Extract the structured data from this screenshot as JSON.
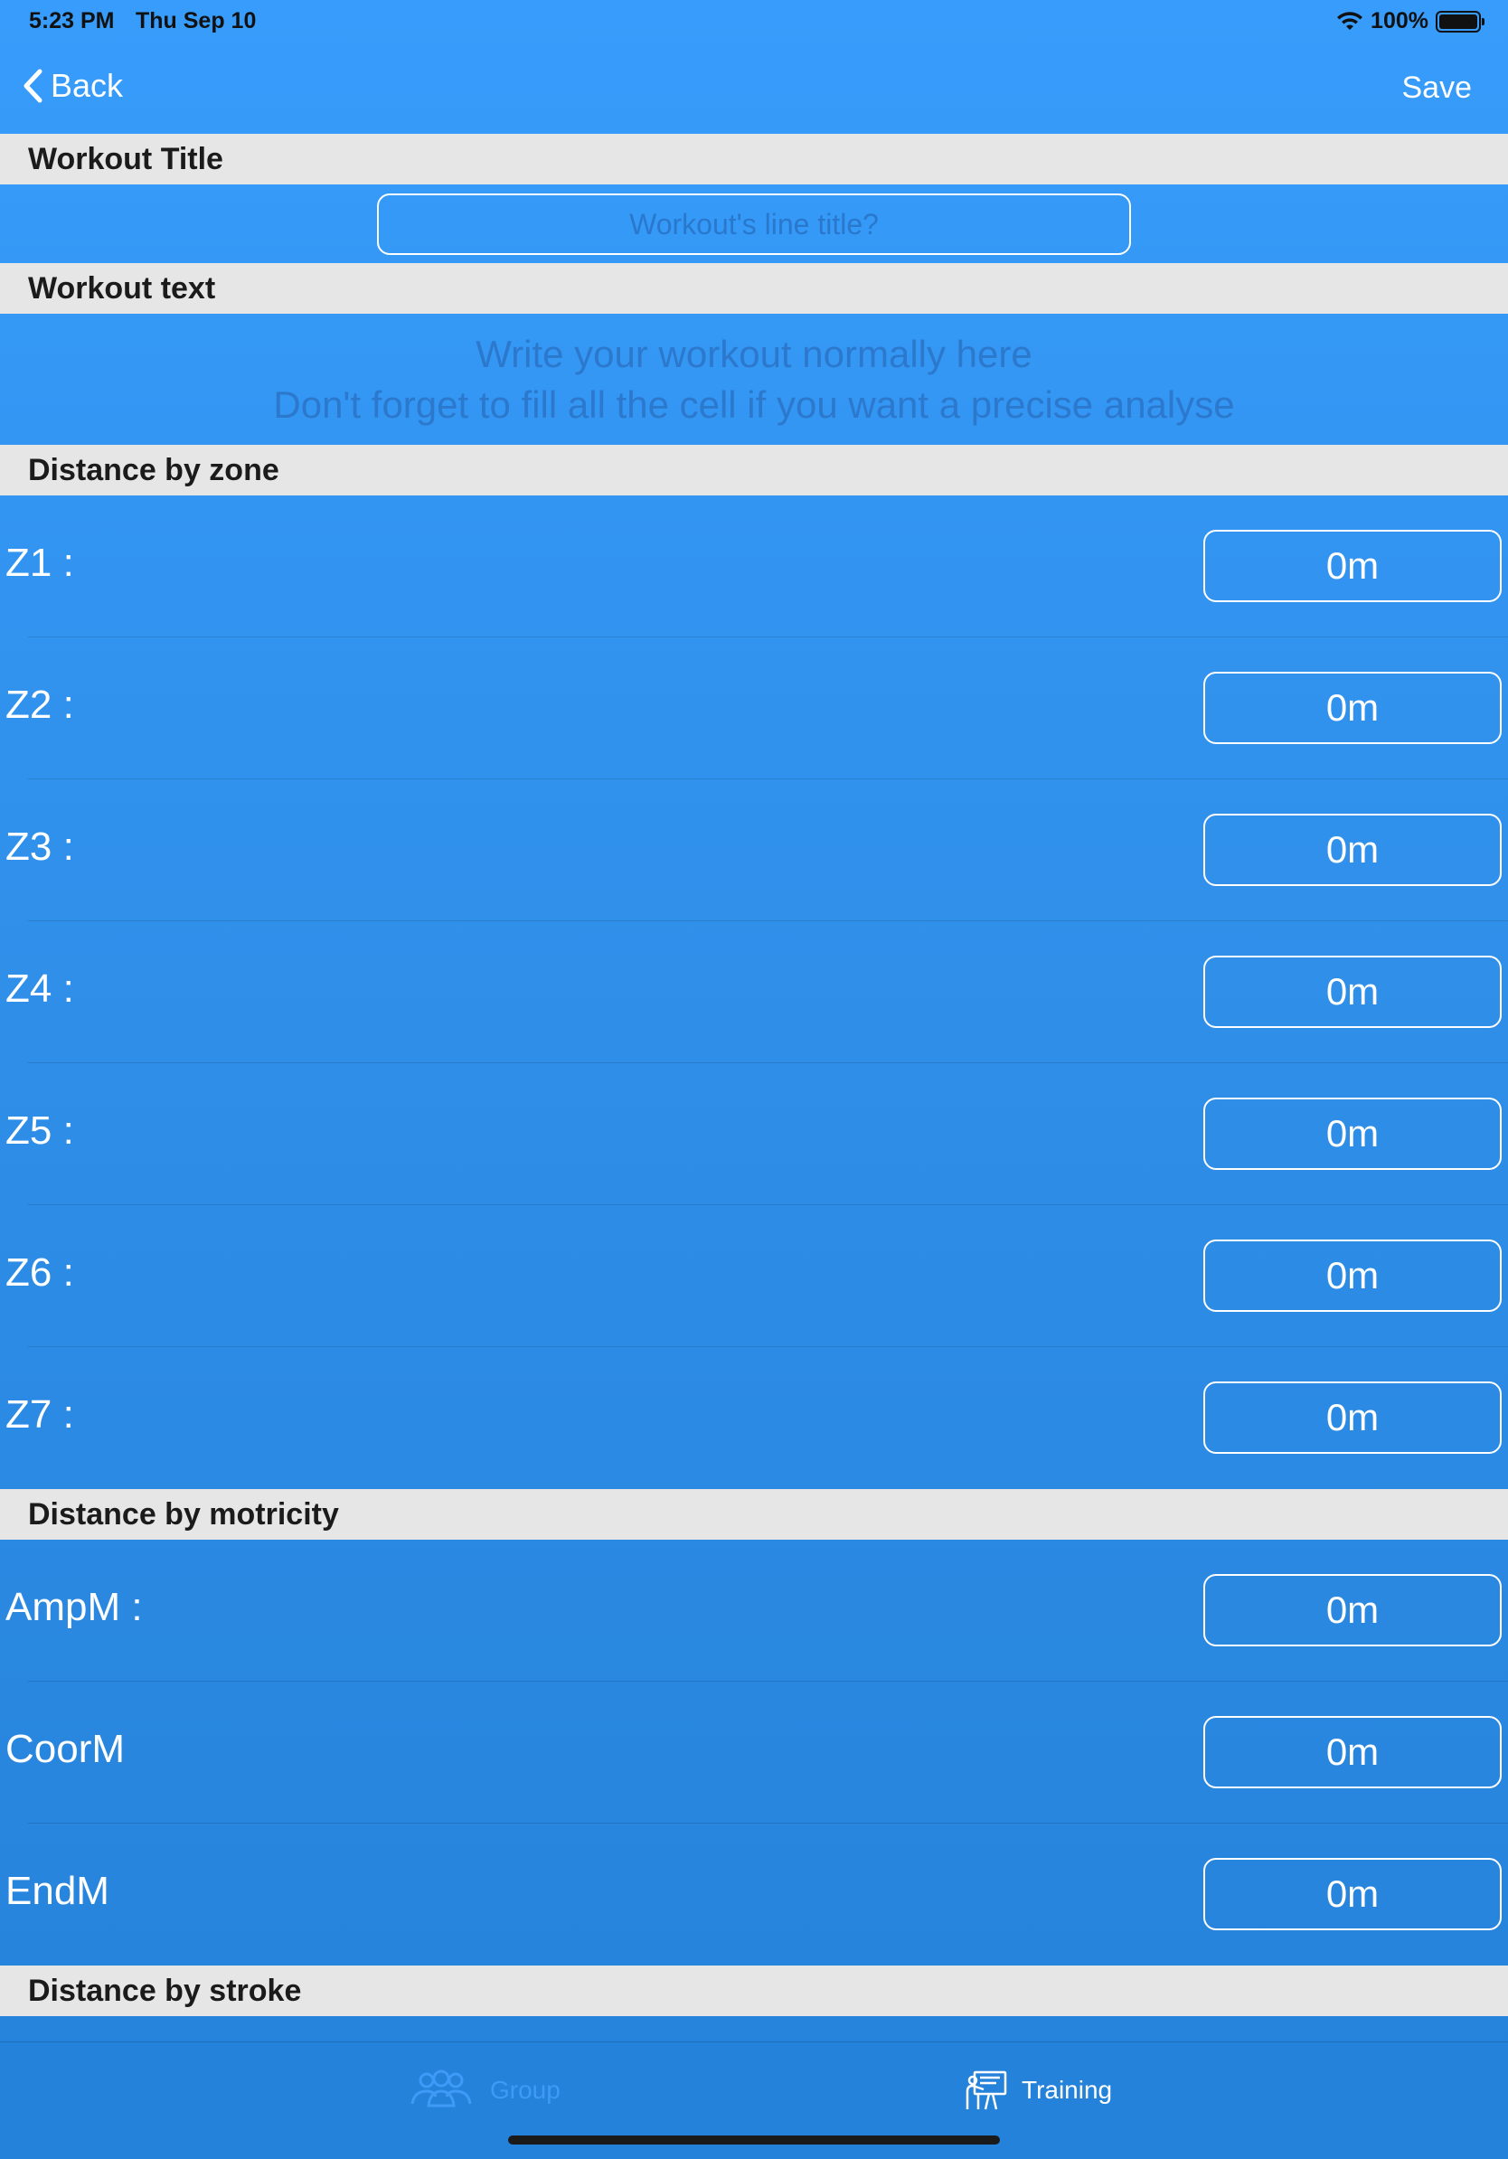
{
  "status": {
    "time": "5:23 PM",
    "date": "Thu Sep 10",
    "battery": "100%"
  },
  "nav": {
    "back_label": "Back",
    "save_label": "Save"
  },
  "sections": {
    "title_header": "Workout Title",
    "text_header": "Workout text",
    "zone_header": "Distance by zone",
    "motricity_header": "Distance by motricity",
    "stroke_header": "Distance by stroke"
  },
  "title_input": {
    "placeholder": "Workout's line title?",
    "value": ""
  },
  "workout_text": {
    "line1": "Write your workout normally here",
    "line2": "Don't forget to fill all the cell if you want a precise analyse"
  },
  "zones": [
    {
      "label": "Z1 :",
      "value": "0m"
    },
    {
      "label": "Z2 :",
      "value": "0m"
    },
    {
      "label": "Z3 :",
      "value": "0m"
    },
    {
      "label": "Z4 :",
      "value": "0m"
    },
    {
      "label": "Z5 :",
      "value": "0m"
    },
    {
      "label": "Z6 :",
      "value": "0m"
    },
    {
      "label": "Z7 :",
      "value": "0m"
    }
  ],
  "motricity": [
    {
      "label": "AmpM :",
      "value": "0m"
    },
    {
      "label": "CoorM",
      "value": "0m"
    },
    {
      "label": "EndM",
      "value": "0m"
    }
  ],
  "tabs": {
    "group": {
      "label": "Group",
      "icon": "group-icon",
      "active_color": "#3e9af6"
    },
    "training": {
      "label": "Training",
      "icon": "training-icon"
    }
  },
  "colors": {
    "background_top": "#379cfb",
    "background_bottom": "#2582da",
    "section_header_bg": "#e6e6e6"
  }
}
